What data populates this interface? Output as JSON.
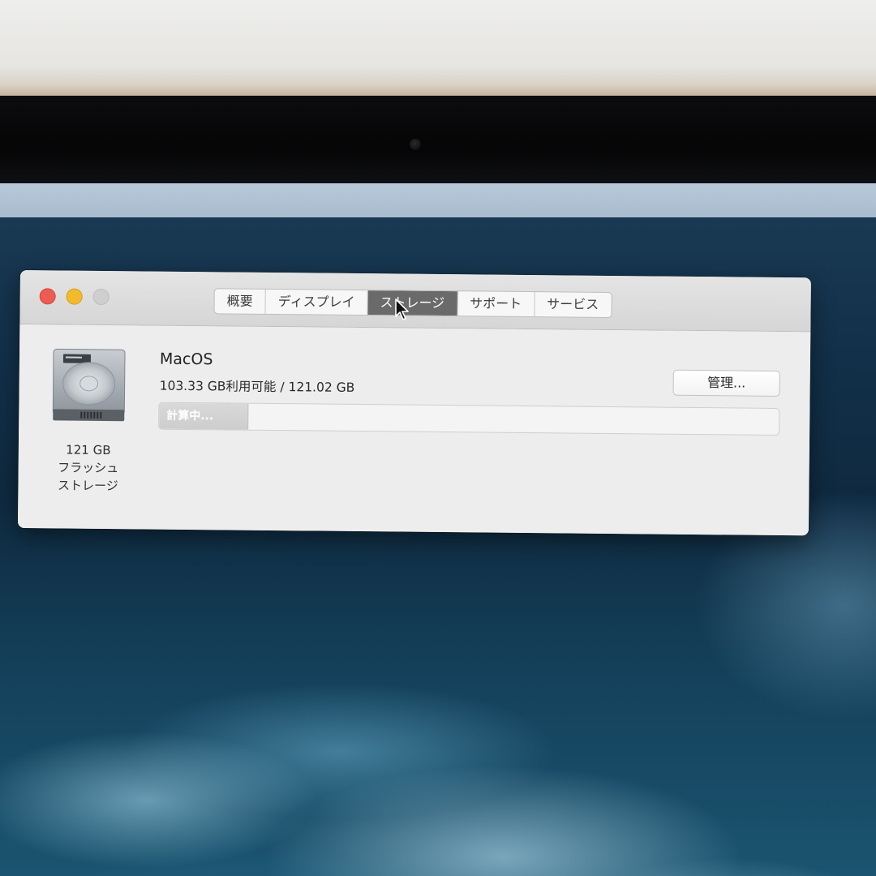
{
  "window": {
    "tabs": [
      {
        "label": "概要",
        "selected": false
      },
      {
        "label": "ディスプレイ",
        "selected": false
      },
      {
        "label": "ストレージ",
        "selected": true
      },
      {
        "label": "サポート",
        "selected": false
      },
      {
        "label": "サービス",
        "selected": false
      }
    ],
    "traffic_lights": {
      "close": "#ee5b53",
      "minimize": "#f1bb2d",
      "zoom": "#cfcfcf"
    }
  },
  "storage": {
    "drive_icon": "hard-drive-icon",
    "drive_caption": [
      "121 GB",
      "フラッシュ",
      "ストレージ"
    ],
    "volume_name": "MacOS",
    "usage_text": "103.33 GB利用可能 / 121.02 GB",
    "manage_label": "管理...",
    "progress_label": "計算中...",
    "progress_fraction": 0.143
  },
  "desktop": {
    "pointer": "arrow-cursor-icon"
  }
}
